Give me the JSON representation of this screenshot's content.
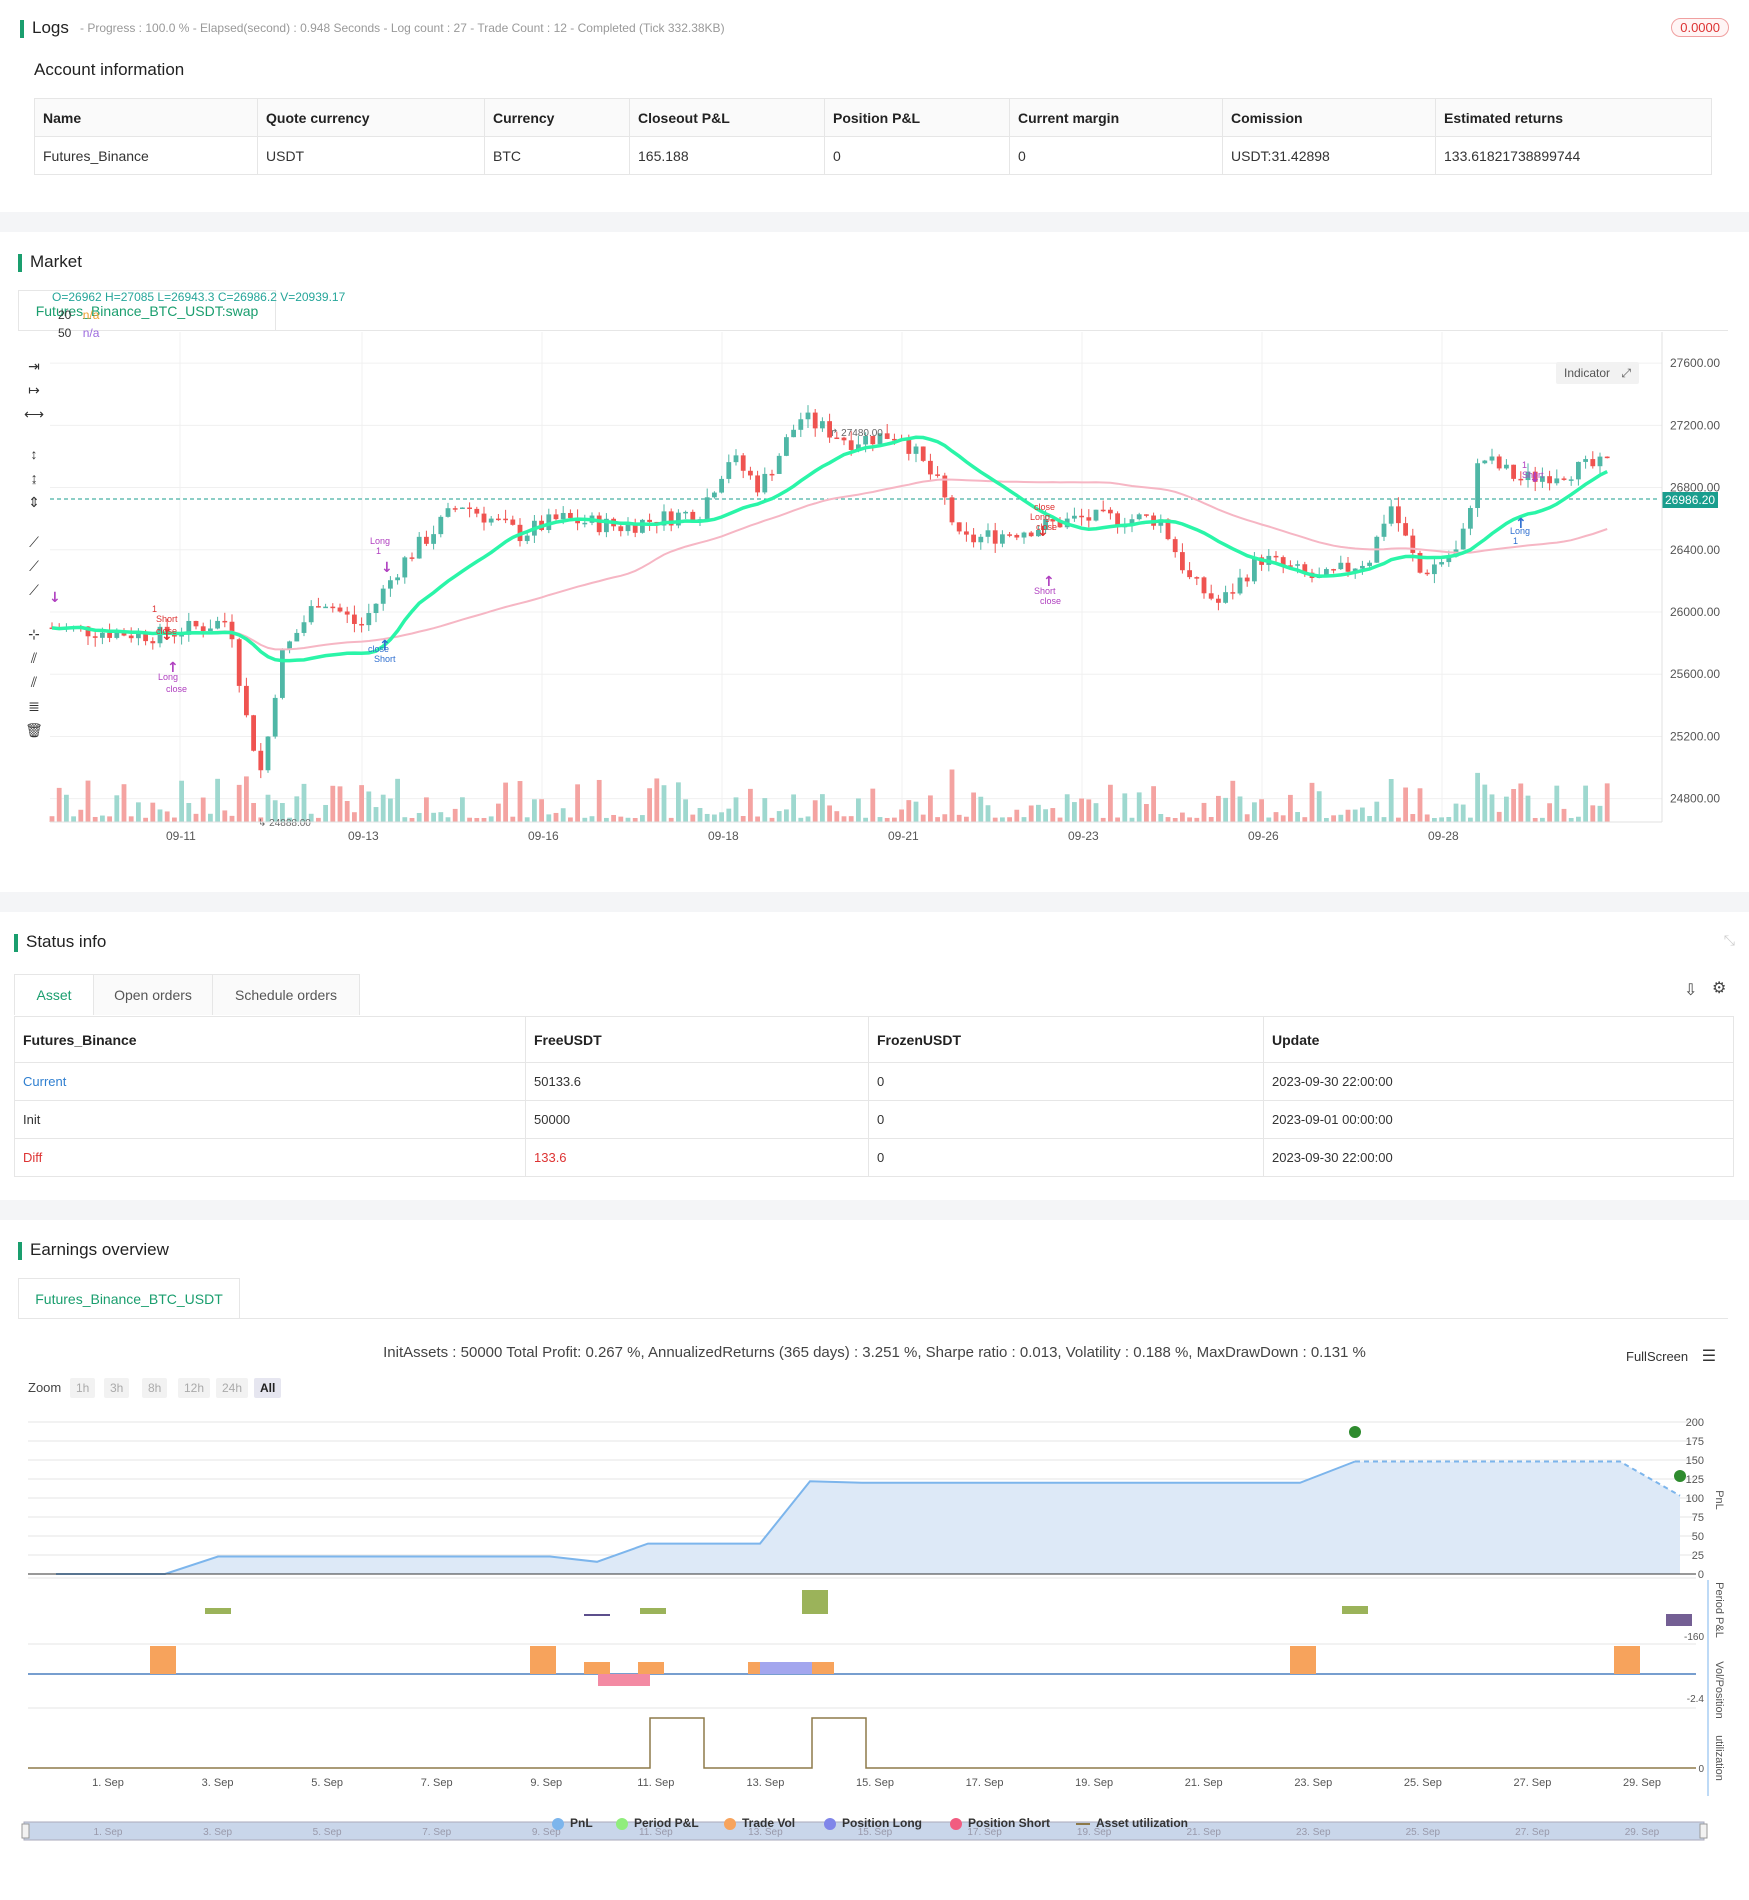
{
  "logs": {
    "title": "Logs",
    "meta": "- Progress : 100.0 % - Elapsed(second) : 0.948  Seconds - Log count : 27 - Trade Count : 12 - Completed (Tick 332.38KB)",
    "badge": "0.0000"
  },
  "account": {
    "title": "Account information",
    "headers": [
      "Name",
      "Quote currency",
      "Currency",
      "Closeout P&L",
      "Position P&L",
      "Current margin",
      "Comission",
      "Estimated returns"
    ],
    "row": [
      "Futures_Binance",
      "USDT",
      "BTC",
      "165.188",
      "0",
      "0",
      "USDT:31.42898",
      "133.61821738899744"
    ]
  },
  "market": {
    "title": "Market",
    "tab": "Futures_Binance_BTC_USDT:swap",
    "ohlc": "O=26962 H=27085 L=26943.3 C=26986.2 V=20939.17",
    "ma": [
      {
        "period": "20",
        "value": "n/a",
        "color": "#f0a030"
      },
      {
        "period": "50",
        "value": "n/a",
        "color": "#9c6ade"
      }
    ],
    "indicator_btn": "Indicator",
    "last_price": "26986.20",
    "high_label": "27480.00",
    "low_label": "24888.00",
    "y_ticks": [
      "27600.00",
      "27200.00",
      "26800.00",
      "26400.00",
      "26000.00",
      "25600.00",
      "25200.00",
      "24800.00"
    ],
    "x_ticks": [
      "09-11",
      "09-13",
      "09-16",
      "09-18",
      "09-21",
      "09-23",
      "09-26",
      "09-28"
    ],
    "signals": [
      "Short",
      "close",
      "Long",
      "close",
      "Short",
      "close",
      "Long",
      "1",
      "Long",
      "close",
      "Short",
      "close",
      "Long",
      "1",
      "1",
      "Short",
      "1",
      "close"
    ]
  },
  "status": {
    "title": "Status info",
    "tabs": [
      "Asset",
      "Open orders",
      "Schedule orders"
    ],
    "headers": [
      "Futures_Binance",
      "FreeUSDT",
      "FrozenUSDT",
      "Update"
    ],
    "rows": [
      {
        "label": "Current",
        "free": "50133.6",
        "frozen": "0",
        "update": "2023-09-30 22:00:00"
      },
      {
        "label": "Init",
        "free": "50000",
        "frozen": "0",
        "update": "2023-09-01 00:00:00"
      },
      {
        "label": "Diff",
        "free": "133.6",
        "frozen": "0",
        "update": "2023-09-30 22:00:00"
      }
    ]
  },
  "earnings": {
    "title": "Earnings overview",
    "tab": "Futures_Binance_BTC_USDT",
    "summary": "InitAssets : 50000 Total Profit: 0.267 %, AnnualizedReturns (365 days) : 3.251 %, Sharpe ratio : 0.013, Volatility : 0.188 %, MaxDrawDown : 0.131 %",
    "fullscreen": "FullScreen",
    "zoom_label": "Zoom",
    "zoom": [
      "1h",
      "3h",
      "8h",
      "12h",
      "24h",
      "All"
    ],
    "pnl_ticks": [
      "200",
      "175",
      "150",
      "125",
      "100",
      "75",
      "50",
      "25",
      "0"
    ],
    "axis_labels": [
      "PnL",
      "Period P&L",
      "Vol/Position",
      "utilization"
    ],
    "period_min": "-160",
    "vol_min": "-2.4",
    "util_min": "0",
    "x_ticks": [
      "1. Sep",
      "3. Sep",
      "5. Sep",
      "7. Sep",
      "9. Sep",
      "11. Sep",
      "13. Sep",
      "15. Sep",
      "17. Sep",
      "19. Sep",
      "21. Sep",
      "23. Sep",
      "25. Sep",
      "27. Sep",
      "29. Sep"
    ],
    "legend": [
      {
        "label": "PnL",
        "color": "#7cb5ec"
      },
      {
        "label": "Period P&L",
        "color": "#90ed7d"
      },
      {
        "label": "Trade Vol",
        "color": "#f7a35c"
      },
      {
        "label": "Position Long",
        "color": "#8085e9"
      },
      {
        "label": "Position Short",
        "color": "#f15c80"
      },
      {
        "label": "Asset utilization",
        "color": "#8d7a4a"
      }
    ]
  }
}
